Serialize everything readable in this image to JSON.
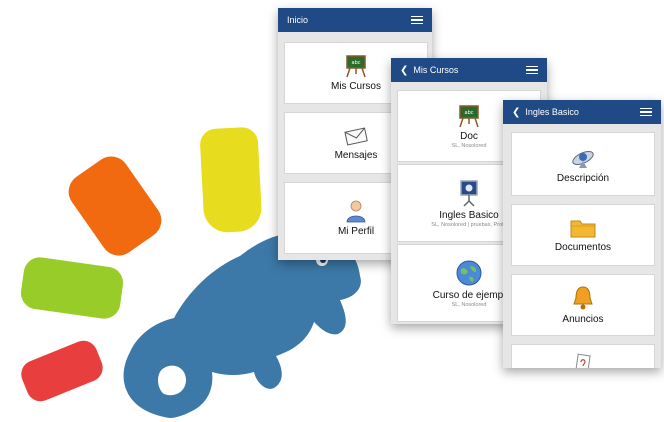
{
  "screens": {
    "inicio": {
      "title": "Inicio",
      "items": [
        {
          "label": "Mis Cursos"
        },
        {
          "label": "Mensajes"
        },
        {
          "label": "Mi Perfil"
        }
      ]
    },
    "mis_cursos": {
      "title": "Mis Cursos",
      "items": [
        {
          "label": "Doc",
          "sub": "SL, Nosolored"
        },
        {
          "label": "Ingles Basico",
          "sub": "SL, Nosolored | pruebas, Profe"
        },
        {
          "label": "Curso de ejempl",
          "sub": "SL, Nosolored"
        }
      ]
    },
    "ingles_basico": {
      "title": "Ingles Basico",
      "items": [
        {
          "label": "Descripción"
        },
        {
          "label": "Documentos"
        },
        {
          "label": "Anuncios"
        }
      ]
    }
  },
  "colors": {
    "header": "#1f4a85",
    "logo_yellow": "#e8dc1f",
    "logo_orange": "#f26a0f",
    "logo_green": "#98cc28",
    "logo_red": "#e83e3e",
    "logo_chameleon": "#3c79a8"
  },
  "icons": [
    "blackboard-icon",
    "envelope-icon",
    "user-icon",
    "keynote-icon",
    "globe-icon",
    "satellite-icon",
    "folder-icon",
    "bell-icon"
  ]
}
